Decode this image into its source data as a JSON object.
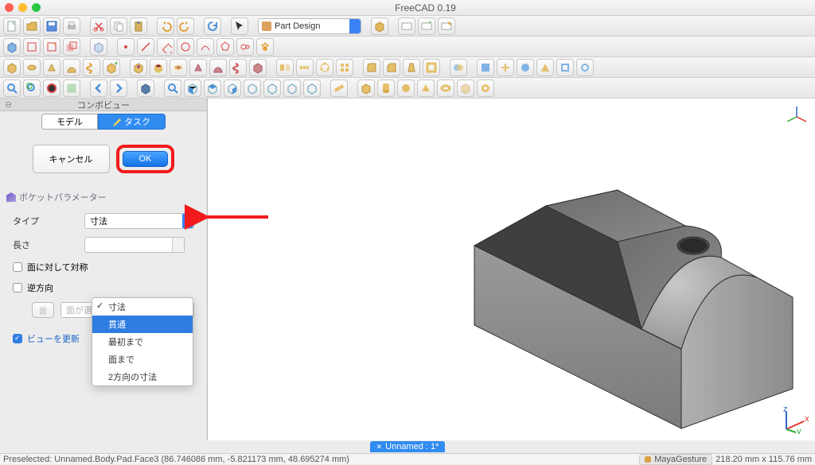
{
  "app": {
    "title": "FreeCAD 0.19"
  },
  "toolbar": {
    "workbench": "Part Design"
  },
  "panel": {
    "title": "コンボビュー",
    "tabs": {
      "model": "モデル",
      "task": "タスク"
    },
    "cancel": "キャンセル",
    "ok": "OK",
    "section": "ポケットパラメーター",
    "type_label": "タイプ",
    "type_value": "寸法",
    "length_label": "長さ",
    "sym_label": "面に対して対称",
    "rev_label": "逆方向",
    "face_btn": "面",
    "face_placeholder": "面が選択されていません",
    "update_label": "ビューを更新"
  },
  "dropdown": {
    "items": [
      "寸法",
      "貫通",
      "最初まで",
      "面まで",
      "2方向の寸法"
    ],
    "checked_index": 0,
    "selected_index": 1
  },
  "viewtab": {
    "label": "Unnamed : 1*"
  },
  "status": {
    "left": "Preselected: Unnamed.Body.Pad.Face3 (86.746086 mm, -5.821173 mm, 48.695274 mm)",
    "nav": "MayaGesture",
    "dims": "218.20 mm x 115.76 mm"
  }
}
